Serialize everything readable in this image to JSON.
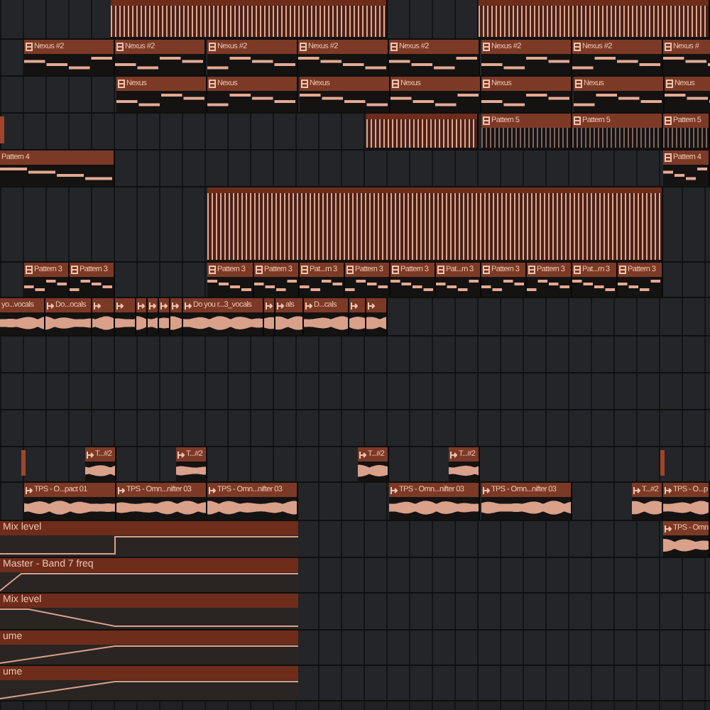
{
  "playlist": {
    "tracks": [
      {
        "clips": [
          {
            "kind": "drum"
          },
          {
            "kind": "drum"
          }
        ]
      },
      {
        "clips": [
          {
            "kind": "notes",
            "label": "Nexus #2"
          },
          {
            "kind": "notes",
            "label": "Nexus #2"
          },
          {
            "kind": "notes",
            "label": "Nexus #2"
          },
          {
            "kind": "notes",
            "label": "Nexus #2"
          },
          {
            "kind": "notes",
            "label": "Nexus #2"
          },
          {
            "kind": "notes",
            "label": "Nexus #2"
          },
          {
            "kind": "notes",
            "label": "Nexus #2"
          },
          {
            "kind": "notes",
            "label": "Nexus #"
          }
        ]
      },
      {
        "clips": [
          {
            "kind": "notes",
            "label": "Nexus"
          },
          {
            "kind": "notes",
            "label": "Nexus"
          },
          {
            "kind": "notes",
            "label": "Nexus"
          },
          {
            "kind": "notes",
            "label": "Nexus"
          },
          {
            "kind": "notes",
            "label": "Nexus"
          },
          {
            "kind": "notes",
            "label": "Nexus"
          },
          {
            "kind": "notes",
            "label": "Nexus"
          }
        ]
      },
      {
        "clips": [
          {
            "kind": "marker"
          },
          {
            "kind": "drum"
          },
          {
            "kind": "steps",
            "label": "Pattern 5"
          },
          {
            "kind": "steps",
            "label": "Pattern 5"
          },
          {
            "kind": "steps",
            "label": "Pattern 5"
          }
        ]
      },
      {
        "clips": [
          {
            "kind": "notes",
            "label": "Pattern 4"
          },
          {
            "kind": "notes",
            "label": "Pattern 4"
          }
        ]
      },
      {
        "clips": [
          {
            "kind": "drum"
          }
        ]
      },
      {
        "clips": [
          {
            "kind": "notes",
            "label": "Pattern 3"
          },
          {
            "kind": "notes",
            "label": "Pattern 3"
          },
          {
            "kind": "notes",
            "label": "Pattern 3"
          },
          {
            "kind": "notes",
            "label": "Pattern 3"
          },
          {
            "kind": "notes",
            "label": "Pat...rn 3"
          },
          {
            "kind": "notes",
            "label": "Pattern 3"
          },
          {
            "kind": "notes",
            "label": "Pattern 3"
          },
          {
            "kind": "notes",
            "label": "Pat...rn 3"
          },
          {
            "kind": "notes",
            "label": "Pattern 3"
          },
          {
            "kind": "notes",
            "label": "Pattern 3"
          },
          {
            "kind": "notes",
            "label": "Pat...rn 3"
          },
          {
            "kind": "notes",
            "label": "Pattern 3"
          }
        ]
      },
      {
        "clips": [
          {
            "kind": "audio",
            "label": "yo...vocals"
          },
          {
            "kind": "audio",
            "label": "Do...ocals"
          },
          {
            "kind": "audio"
          },
          {
            "kind": "audio"
          },
          {
            "kind": "audio"
          },
          {
            "kind": "audio"
          },
          {
            "kind": "audio"
          },
          {
            "kind": "audio"
          },
          {
            "kind": "audio",
            "label": "Do you r...3_vocals"
          },
          {
            "kind": "audio"
          },
          {
            "kind": "audio",
            "label": "als"
          },
          {
            "kind": "audio",
            "label": "D...cals"
          },
          {
            "kind": "audio"
          },
          {
            "kind": "audio"
          }
        ]
      },
      {
        "clips": [
          {
            "kind": "marker"
          },
          {
            "kind": "audio",
            "label": "T...#2"
          },
          {
            "kind": "audio",
            "label": "T...#2"
          },
          {
            "kind": "audio",
            "label": "T...#2"
          },
          {
            "kind": "audio",
            "label": "T...#2"
          },
          {
            "kind": "marker"
          }
        ]
      },
      {
        "clips": [
          {
            "kind": "audio",
            "label": "TPS - O...pact 01"
          },
          {
            "kind": "audio",
            "label": "TPS - Omn...nifter 03"
          },
          {
            "kind": "audio",
            "label": "TPS - Omn...nifter 03"
          },
          {
            "kind": "audio",
            "label": "TPS - Omn...nifter 03"
          },
          {
            "kind": "audio",
            "label": "TPS - Omn...nifter 03"
          },
          {
            "kind": "audio",
            "label": "T...#2"
          },
          {
            "kind": "audio",
            "label": "TPS - O...p"
          }
        ]
      },
      {
        "clips": [
          {
            "kind": "automation",
            "label": "Mix level"
          },
          {
            "kind": "audio",
            "label": "TPS - Omn"
          }
        ]
      },
      {
        "clips": [
          {
            "kind": "automation",
            "label": "Master - Band 7 freq"
          }
        ]
      },
      {
        "clips": [
          {
            "kind": "automation",
            "label": "Mix level"
          }
        ]
      },
      {
        "clips": [
          {
            "kind": "automation",
            "label": "ume"
          }
        ]
      },
      {
        "clips": [
          {
            "kind": "automation",
            "label": "ume"
          }
        ]
      }
    ]
  }
}
